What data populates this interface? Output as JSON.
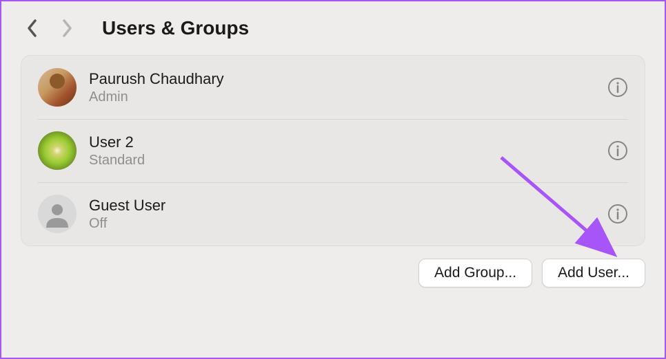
{
  "header": {
    "title": "Users & Groups"
  },
  "users": [
    {
      "name": "Paurush Chaudhary",
      "role": "Admin"
    },
    {
      "name": "User 2",
      "role": "Standard"
    },
    {
      "name": "Guest User",
      "role": "Off"
    }
  ],
  "footer": {
    "add_group_label": "Add Group...",
    "add_user_label": "Add User..."
  },
  "colors": {
    "accent_arrow": "#a855f7"
  }
}
